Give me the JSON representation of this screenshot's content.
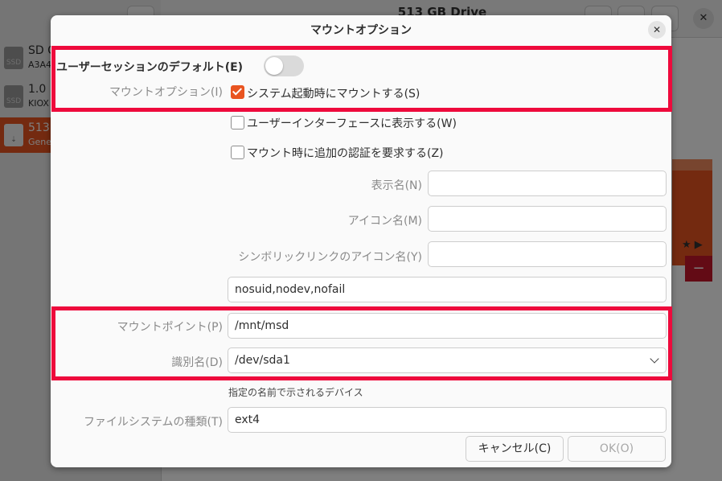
{
  "background": {
    "window_title": "513 GB Drive",
    "drives": [
      {
        "title": "SD C",
        "subtitle": "A3A4",
        "icon": "SSD",
        "selected": false
      },
      {
        "title": "1.0",
        "subtitle": "KIOX",
        "icon": "SSD",
        "selected": false
      },
      {
        "title": "513",
        "subtitle": "Gene",
        "icon": "usb-icon",
        "selected": true
      }
    ],
    "partition_icons": "★ ▶",
    "minus_label": "−"
  },
  "dialog": {
    "title": "マウントオプション",
    "close_label": "✕",
    "user_defaults_label": "ユーザーセッションのデフォルト(E)",
    "user_defaults_on": false,
    "mount_options_label": "マウントオプション(I)",
    "checkboxes": [
      {
        "label": "システム起動時にマウントする(S)",
        "checked": true
      },
      {
        "label": "ユーザーインターフェースに表示する(W)",
        "checked": false
      },
      {
        "label": "マウント時に追加の認証を要求する(Z)",
        "checked": false
      }
    ],
    "display_name_label": "表示名(N)",
    "display_name_value": "",
    "icon_name_label": "アイコン名(M)",
    "icon_name_value": "",
    "symbolic_icon_label": "シンボリックリンクのアイコン名(Y)",
    "symbolic_icon_value": "",
    "options_value": "nosuid,nodev,nofail",
    "mount_point_label": "マウントポイント(P)",
    "mount_point_value": "/mnt/msd",
    "identify_label": "識別名(D)",
    "identify_value": "/dev/sda1",
    "identify_hint": "指定の名前で示されるデバイス",
    "fs_type_label": "ファイルシステムの種類(T)",
    "fs_type_value": "ext4",
    "cancel_label": "キャンセル(C)",
    "ok_label": "OK(O)"
  },
  "colors": {
    "accent": "#e95420",
    "highlight": "#ee0a3c"
  }
}
